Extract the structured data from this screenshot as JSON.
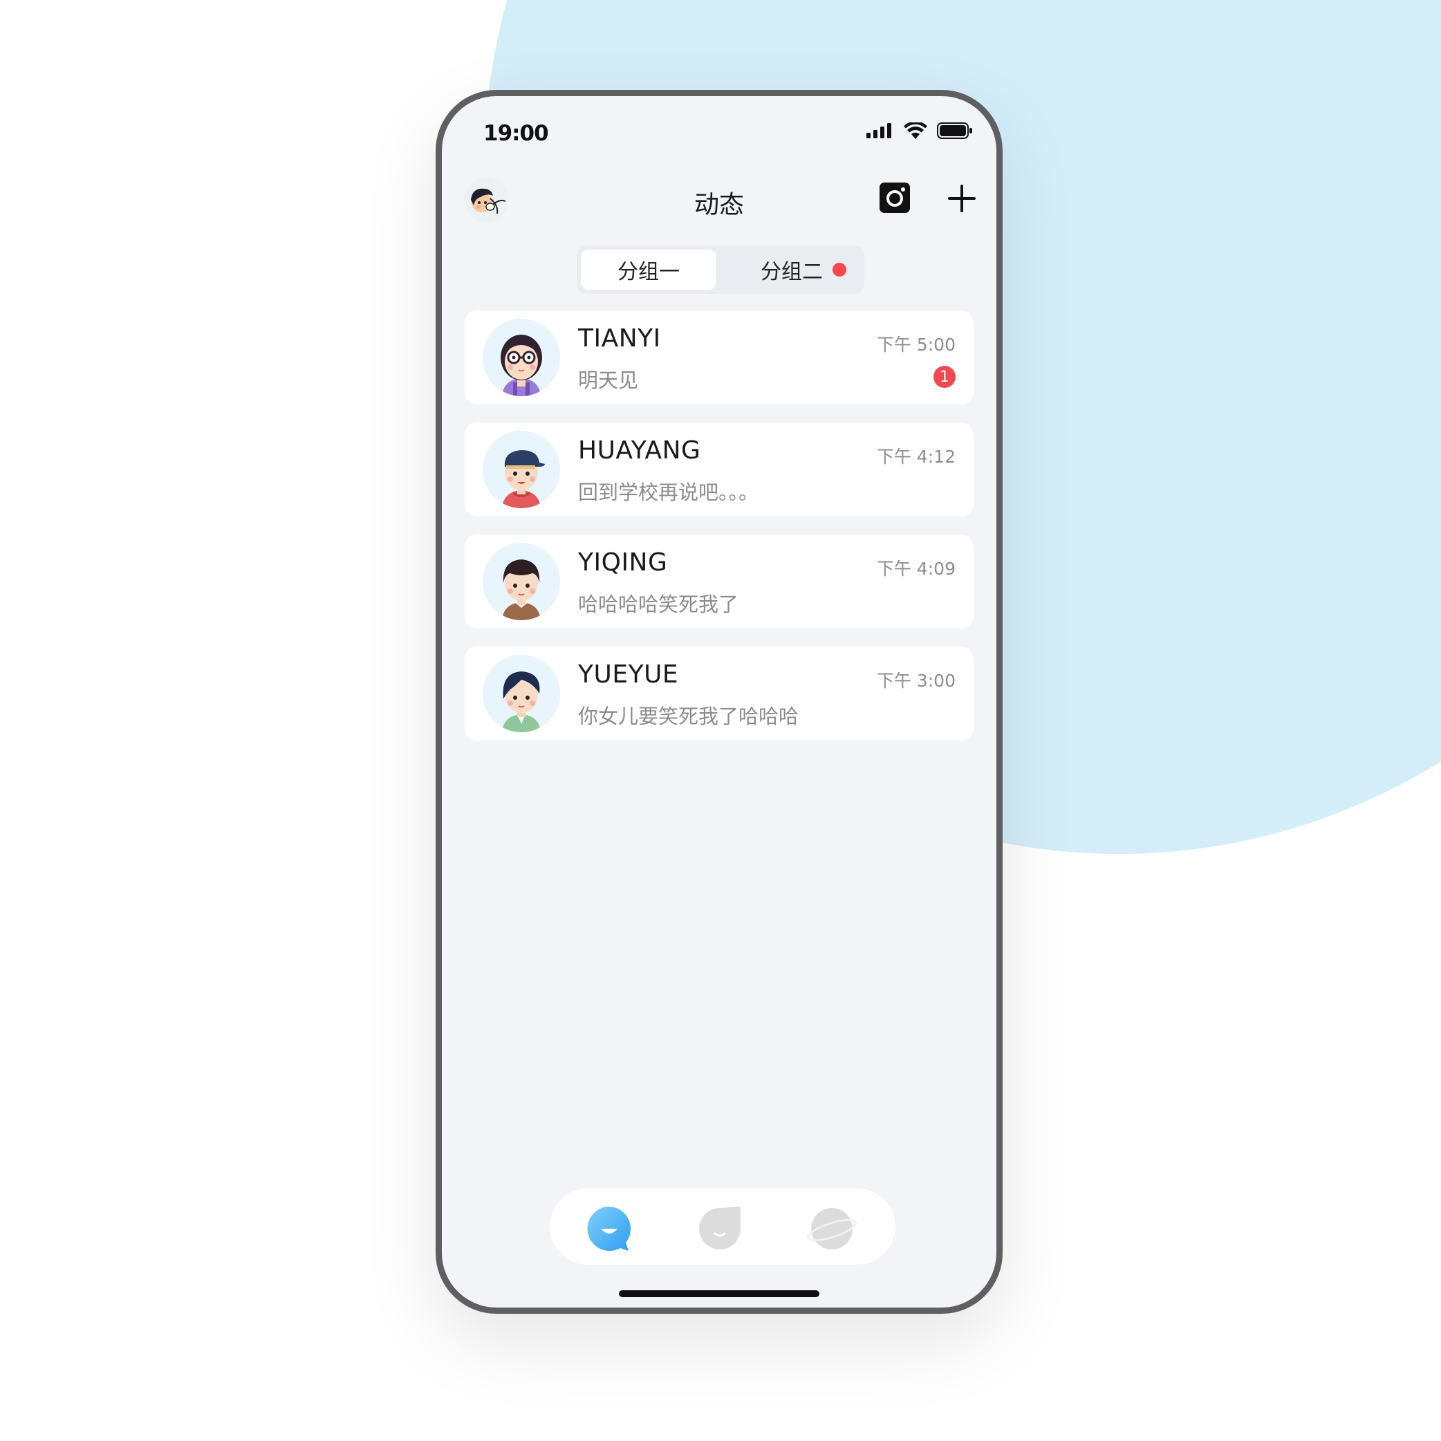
{
  "status_bar": {
    "time": "19:00",
    "icons": [
      "cellular-signal-icon",
      "wifi-icon",
      "battery-icon"
    ]
  },
  "header": {
    "title": "动态",
    "left_icon": "user-avatar",
    "right_icons": [
      "camera-icon",
      "plus-icon"
    ]
  },
  "segments": {
    "items": [
      {
        "label": "分组一",
        "active": true
      },
      {
        "label": "分组二",
        "active": false,
        "dot": true
      }
    ]
  },
  "chats": [
    {
      "name": "TIANYI",
      "message": "明天见",
      "time": "下午 5:00",
      "unread": "1"
    },
    {
      "name": "HUAYANG",
      "message": "回到学校再说吧。。。",
      "time": "下午 4:12"
    },
    {
      "name": "YIQING",
      "message": "哈哈哈哈笑死我了",
      "time": "下午 4:09"
    },
    {
      "name": "YUEYUE",
      "message": "你女儿要笑死我了哈哈哈",
      "time": "下午 3:00"
    }
  ],
  "tabbar": {
    "items": [
      {
        "icon": "chat-bubble-icon",
        "active": true
      },
      {
        "icon": "drop-face-icon",
        "active": false
      },
      {
        "icon": "planet-icon",
        "active": false
      }
    ]
  },
  "colors": {
    "accent": "#3fb2f4",
    "badge": "#f5474f",
    "background_blob": "#d4eef9",
    "screen_bg": "#f2f4f8",
    "inactive_icon": "#dcdcdc"
  }
}
